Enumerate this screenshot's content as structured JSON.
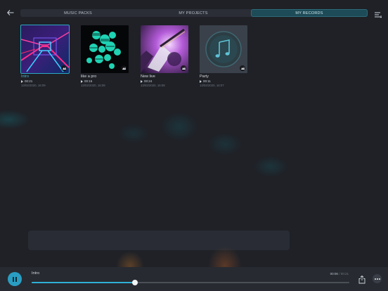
{
  "nav": {
    "back_icon": "back-arrow-icon",
    "tabs": [
      {
        "label": "MUSIC PACKS",
        "active": false
      },
      {
        "label": "MY PROJECTS",
        "active": false
      },
      {
        "label": "MY RECORDS",
        "active": true
      }
    ],
    "menu_icon": "list-menu-icon"
  },
  "records": [
    {
      "title": "Intro",
      "duration": "00:21",
      "date": "13/02/2020, 16:09",
      "selected": true,
      "cover": "neon-tunnel"
    },
    {
      "title": "like a pro",
      "duration": "00:15",
      "date": "13/02/2020, 16:08",
      "selected": false,
      "cover": "green-spheres"
    },
    {
      "title": "New live",
      "duration": "00:24",
      "date": "13/02/2020, 16:08",
      "selected": false,
      "cover": "guitar-photo"
    },
    {
      "title": "Party",
      "duration": "00:11",
      "date": "13/02/2020, 16:07",
      "selected": false,
      "cover": "music-note-placeholder"
    }
  ],
  "player": {
    "track_title": "Intro",
    "elapsed": "00:06",
    "separator": "/",
    "total": "00:21",
    "progress_fraction": 0.325,
    "pause_icon": "pause-icon",
    "share_icon": "share-icon",
    "more_icon": "more-dots-icon"
  },
  "colors": {
    "accent": "#2a9ec2",
    "background": "#1f2127",
    "tab_active": "#1d4b57"
  }
}
